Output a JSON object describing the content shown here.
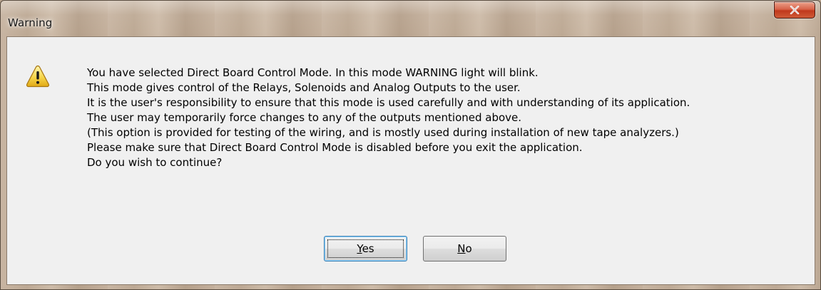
{
  "window": {
    "title": "Warning",
    "close_icon": "close-icon"
  },
  "dialog": {
    "icon": "warning-icon",
    "message_lines": [
      "You have selected Direct Board Control Mode. In this mode WARNING light will blink.",
      "This mode gives control of the Relays, Solenoids and Analog Outputs to the user.",
      "It is the user's responsibility to ensure that this mode is used carefully and with understanding of its application.",
      "The user may temporarily force changes to any of the outputs mentioned above.",
      "(This option is provided for testing of the wiring, and is mostly used during installation of new tape analyzers.)",
      "Please make sure that Direct Board Control Mode is disabled before you exit the application.",
      "Do you wish to continue?"
    ],
    "buttons": {
      "yes": {
        "mnemonic": "Y",
        "rest": "es"
      },
      "no": {
        "mnemonic": "N",
        "rest": "o"
      }
    }
  },
  "colors": {
    "close_button": "#c0391c",
    "warning_icon_fill": "#f6d54a",
    "default_button_border": "#3c7fb1"
  }
}
